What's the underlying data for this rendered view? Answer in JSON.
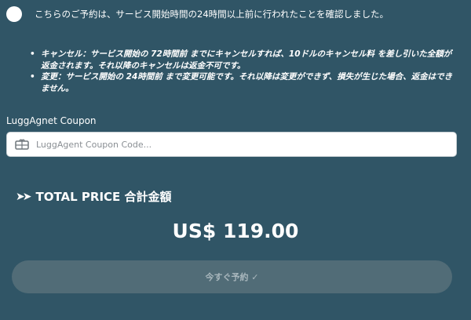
{
  "confirmation": {
    "text": "こちらのご予約は、サービス開始時間の24時間以上前に行われたことを確認しました。"
  },
  "policy": {
    "items": [
      "キャンセル：サービス開始の 72時間前 までにキャンセルすれば、10ドルのキャンセル料 を差し引いた全額が返金されます。それ以降のキャンセルは返金不可です。",
      "変更：サービス開始の 24時間前 まで変更可能です。それ以降は変更ができず、損失が生じた場合、返金はできません。"
    ]
  },
  "coupon": {
    "label": "LuggAgnet Coupon",
    "placeholder": "LuggAgent Coupon Code...",
    "value": "",
    "icon": "coupon-ticket-icon"
  },
  "total": {
    "arrows": "➤➤",
    "label": "TOTAL PRICE 合計金額",
    "price": "US$ 119.00"
  },
  "reserve_button": {
    "label": "今すぐ予約 ✓"
  },
  "colors": {
    "background": "#305566",
    "button": "#516c77",
    "button_text": "#a9b7bd"
  }
}
